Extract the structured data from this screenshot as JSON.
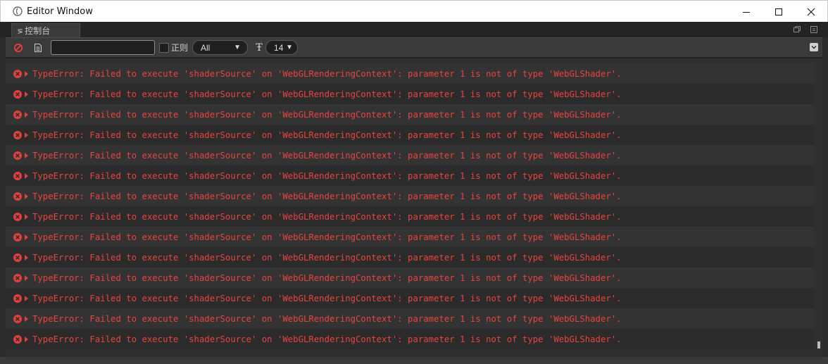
{
  "window": {
    "title": "Editor Window"
  },
  "tab": {
    "label": "控制台",
    "icon": "console-icon"
  },
  "toolbar": {
    "search_value": "",
    "regex_label": "正则",
    "level_value": "All",
    "font_size_value": "14"
  },
  "log": {
    "messages": [
      "TypeError: Failed to execute 'shaderSource' on 'WebGLRenderingContext': parameter 1 is not of type 'WebGLShader'.",
      "TypeError: Failed to execute 'shaderSource' on 'WebGLRenderingContext': parameter 1 is not of type 'WebGLShader'.",
      "TypeError: Failed to execute 'shaderSource' on 'WebGLRenderingContext': parameter 1 is not of type 'WebGLShader'.",
      "TypeError: Failed to execute 'shaderSource' on 'WebGLRenderingContext': parameter 1 is not of type 'WebGLShader'.",
      "TypeError: Failed to execute 'shaderSource' on 'WebGLRenderingContext': parameter 1 is not of type 'WebGLShader'.",
      "TypeError: Failed to execute 'shaderSource' on 'WebGLRenderingContext': parameter 1 is not of type 'WebGLShader'.",
      "TypeError: Failed to execute 'shaderSource' on 'WebGLRenderingContext': parameter 1 is not of type 'WebGLShader'.",
      "TypeError: Failed to execute 'shaderSource' on 'WebGLRenderingContext': parameter 1 is not of type 'WebGLShader'.",
      "TypeError: Failed to execute 'shaderSource' on 'WebGLRenderingContext': parameter 1 is not of type 'WebGLShader'.",
      "TypeError: Failed to execute 'shaderSource' on 'WebGLRenderingContext': parameter 1 is not of type 'WebGLShader'.",
      "TypeError: Failed to execute 'shaderSource' on 'WebGLRenderingContext': parameter 1 is not of type 'WebGLShader'.",
      "TypeError: Failed to execute 'shaderSource' on 'WebGLRenderingContext': parameter 1 is not of type 'WebGLShader'.",
      "TypeError: Failed to execute 'shaderSource' on 'WebGLRenderingContext': parameter 1 is not of type 'WebGLShader'.",
      "TypeError: Failed to execute 'shaderSource' on 'WebGLRenderingContext': parameter 1 is not of type 'WebGLShader'."
    ]
  },
  "colors": {
    "error_text": "#e8443f",
    "panel_bg": "#2f2f2f",
    "toolbar_bg": "#3a3a3a"
  }
}
